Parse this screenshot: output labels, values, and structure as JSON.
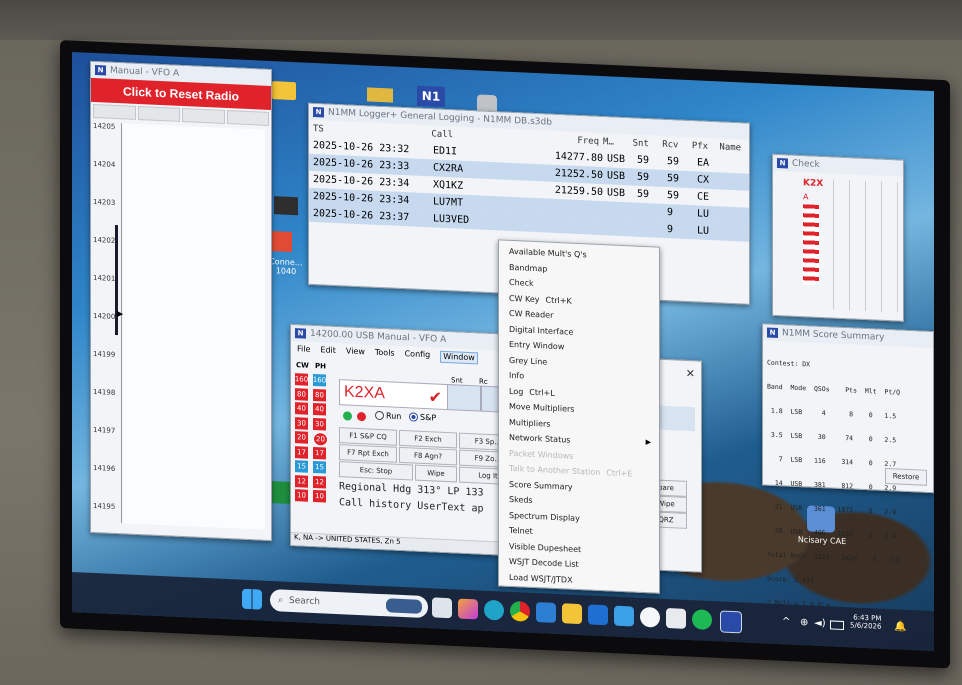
{
  "colors": {
    "accent": "#e0232b",
    "n1mm_blue": "#2a4aa8",
    "selected_row": "#c6d9ef"
  },
  "desktop_icons": [
    {
      "name": "Conne…",
      "label": "Conne… 1040"
    },
    {
      "name": "Ncisary CAE",
      "label": "Ncisary CAE"
    },
    {
      "name": "Nisy",
      "label": "N1MM"
    }
  ],
  "bandmap": {
    "title": "Manual - VFO A",
    "reset_button": "Click to Reset Radio",
    "freqs": [
      "14205",
      "14204",
      "14203",
      "14202",
      "14201",
      "14200",
      "14199",
      "14198",
      "14197",
      "14196",
      "14195"
    ]
  },
  "log": {
    "title": "N1MM Logger+ General Logging - N1MM DB.s3db",
    "headers": {
      "ts": "TS",
      "call": "Call",
      "freq": "Freq",
      "mode": "M…",
      "snt": "Snt",
      "rcv": "Rcv",
      "pfx": "Pfx",
      "name": "Name"
    },
    "rows": [
      {
        "ts": "2025-10-26 23:32",
        "call": "ED1I",
        "freq": "14277.80",
        "mode": "USB",
        "snt": "59",
        "rcv": "59",
        "pfx": "EA"
      },
      {
        "ts": "2025-10-26 23:33",
        "call": "CX2RA",
        "freq": "21252.50",
        "mode": "USB",
        "snt": "59",
        "rcv": "59",
        "pfx": "CX"
      },
      {
        "ts": "2025-10-26 23:34",
        "call": "XQ1KZ",
        "freq": "21259.50",
        "mode": "USB",
        "snt": "59",
        "rcv": "59",
        "pfx": "CE"
      },
      {
        "ts": "2025-10-26 23:34",
        "call": "LU7MT",
        "freq": "",
        "mode": "",
        "snt": "",
        "rcv": "9",
        "pfx": "LU"
      },
      {
        "ts": "2025-10-26 23:37",
        "call": "LU3VED",
        "freq": "",
        "mode": "",
        "snt": "",
        "rcv": "9",
        "pfx": "LU"
      }
    ]
  },
  "entry": {
    "title": "14200.00 USB Manual - VFO A",
    "menu": [
      "File",
      "Edit",
      "View",
      "Tools",
      "Config",
      "Window"
    ],
    "band_header": {
      "cw": "CW",
      "ph": "PH"
    },
    "bands": [
      "160",
      "80",
      "40",
      "30",
      "20",
      "17",
      "15",
      "12",
      "10"
    ],
    "bands_ph": [
      "160",
      "80",
      "40",
      "30",
      "20",
      "17",
      "15",
      "12",
      "10"
    ],
    "call": "K2XA",
    "snt_label": "Snt",
    "rcv_label": "Rc",
    "run_label": "Run",
    "sp_label": "S&P",
    "buttons": [
      "F1 S&P CQ",
      "F2 Exch",
      "F3 Sp…",
      "F7 Rpt Exch",
      "F8 Agn?",
      "F9 Zo…",
      "Esc: Stop",
      "Wipe",
      "Log It"
    ],
    "info_line1": "Regional Hdg 313° LP 133",
    "info_line2": "Call history UserText ap",
    "status": "K, NA -> UNITED STATES, Zn 5",
    "side_buttons": [
      "pare",
      "Wipe",
      "QRZ"
    ]
  },
  "context_menu": {
    "items": [
      {
        "label": "Available Mult's Q's",
        "shortcut": ""
      },
      {
        "label": "Bandmap",
        "shortcut": ""
      },
      {
        "label": "Check",
        "shortcut": ""
      },
      {
        "label": "CW Key",
        "shortcut": "Ctrl+K"
      },
      {
        "label": "CW Reader",
        "shortcut": ""
      },
      {
        "label": "Digital Interface",
        "shortcut": ""
      },
      {
        "label": "Entry Window",
        "shortcut": ""
      },
      {
        "label": "Grey Line",
        "shortcut": ""
      },
      {
        "label": "Info",
        "shortcut": ""
      },
      {
        "label": "Log",
        "shortcut": "Ctrl+L"
      },
      {
        "label": "Move Multipliers",
        "shortcut": ""
      },
      {
        "label": "Multipliers",
        "shortcut": ""
      },
      {
        "label": "Network Status",
        "shortcut": ""
      },
      {
        "label": "Packet Windows",
        "shortcut": "",
        "disabled": true
      },
      {
        "label": "Talk to Another Station",
        "shortcut": "Ctrl+E",
        "disabled": true
      },
      {
        "label": "Score Summary",
        "shortcut": ""
      },
      {
        "label": "Skeds",
        "shortcut": ""
      },
      {
        "label": "Spectrum Display",
        "shortcut": ""
      },
      {
        "label": "Telnet",
        "shortcut": ""
      },
      {
        "label": "Visible Dupesheet",
        "shortcut": ""
      },
      {
        "label": "WSJT Decode List",
        "shortcut": ""
      },
      {
        "label": "Load WSJT/JTDX",
        "shortcut": ""
      }
    ]
  },
  "check": {
    "title": "Check",
    "callsign": "K2X",
    "calls": [
      "A"
    ]
  },
  "score": {
    "title": "N1MM Score Summary",
    "contest": "Contest: DX",
    "header": "Band  Mode  QSOs    Pts  Mlt  Pt/Q",
    "rows": [
      " 1.8  LSB     4      8    0   1.5",
      " 3.5  LSB    30     74    0   2.5",
      "   7  LSB   116    314    0   2.7",
      "  14  USB   381    812    0   2.9",
      "  21  USB   361   1077    0   2.9",
      "  28  USB   405   1189    0   2.9",
      "Total Both  1282   3428    0   2.9"
    ],
    "score_line": "Score: 3,418",
    "mult_line": "1 Mult = 1.0 Q's",
    "restore": "Restore"
  },
  "taskbar": {
    "search_placeholder": "Search",
    "time": "6:43 PM",
    "date": "5/6/2026"
  }
}
